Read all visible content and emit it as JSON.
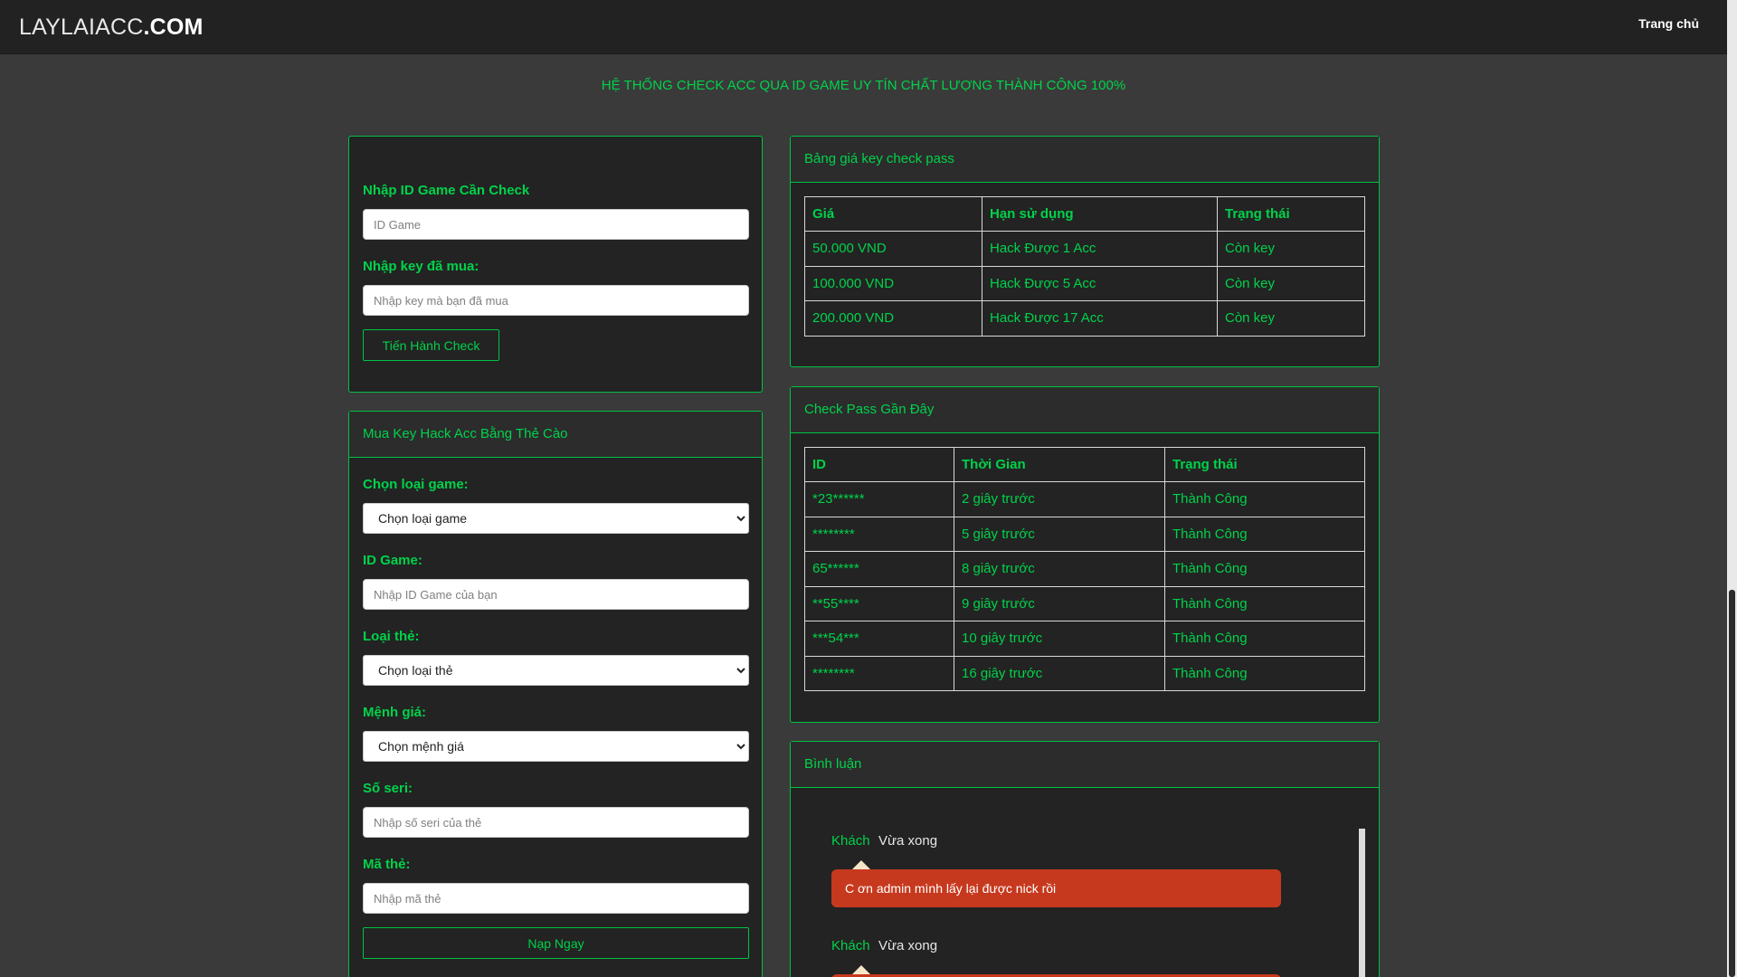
{
  "navbar": {
    "brand_light": "LAYLAIACC",
    "brand_bold": ".COM",
    "home_link": "Trang chủ"
  },
  "headline": "HỆ THỐNG CHECK ACC QUA ID GAME UY TÍN CHẤT LƯỢNG THÀNH CÔNG 100%",
  "check_form": {
    "id_label": "Nhập ID Game Cần Check",
    "id_placeholder": "ID Game",
    "key_label": "Nhập key đã mua:",
    "key_placeholder": "Nhập key mà bạn đã mua",
    "submit_label": "Tiến Hành Check"
  },
  "buy_form": {
    "title": "Mua Key Hack Acc Bằng Thẻ Cào",
    "game_label": "Chọn loại game:",
    "game_selected": "Chọn loại game",
    "id_label": "ID Game:",
    "id_placeholder": "Nhập ID Game của bạn",
    "card_label": "Loại thẻ:",
    "card_selected": "Chọn loại thẻ",
    "value_label": "Mệnh giá:",
    "value_selected": "Chọn mệnh giá",
    "serial_label": "Số seri:",
    "serial_placeholder": "Nhập số seri của thẻ",
    "code_label": "Mã thẻ:",
    "code_placeholder": "Nhập mã thẻ",
    "submit_label": "Nạp Ngay"
  },
  "price_table": {
    "title": "Bảng giá key check pass",
    "headers": [
      "Giá",
      "Hạn sử dụng",
      "Trạng thái"
    ],
    "rows": [
      [
        "50.000 VND",
        "Hack Được 1 Acc",
        "Còn key"
      ],
      [
        "100.000 VND",
        "Hack Được 5 Acc",
        "Còn key"
      ],
      [
        "200.000 VND",
        "Hack Được 17 Acc",
        "Còn key"
      ]
    ]
  },
  "recent_table": {
    "title": "Check Pass Gần Đây",
    "headers": [
      "ID",
      "Thời Gian",
      "Trạng thái"
    ],
    "rows": [
      [
        "*23******",
        "2 giây trước",
        "Thành Công"
      ],
      [
        "********",
        "5 giây trước",
        "Thành Công"
      ],
      [
        "65******",
        "8 giây trước",
        "Thành Công"
      ],
      [
        "**55****",
        "9 giây trước",
        "Thành Công"
      ],
      [
        "***54***",
        "10 giây trước",
        "Thành Công"
      ],
      [
        "********",
        "16 giây trước",
        "Thành Công"
      ]
    ]
  },
  "comments": {
    "title": "Bình luận",
    "items": [
      {
        "author": "Khách",
        "time": "Vừa xong",
        "text": "C ơn admin mình lấy lại được nick rồi"
      },
      {
        "author": "Khách",
        "time": "Vừa xong",
        "text": ""
      }
    ]
  },
  "colors": {
    "accent": "#00d24a",
    "background": "#3a3a3a",
    "panel": "#232323",
    "bubble": "#c7391e"
  }
}
